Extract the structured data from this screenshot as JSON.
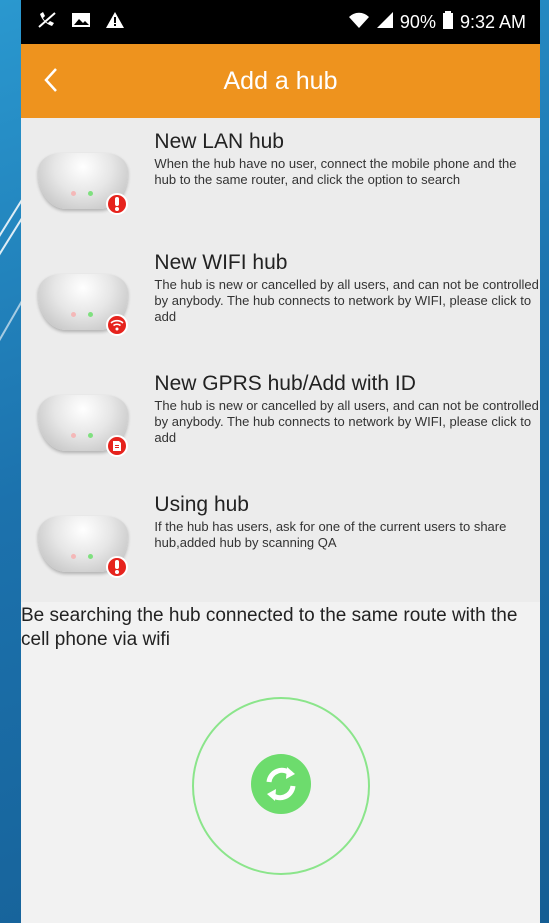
{
  "status_bar": {
    "icons_left": [
      "no-call-icon",
      "image-icon",
      "warning-icon"
    ],
    "battery": "90%",
    "time": "9:32 AM"
  },
  "header": {
    "title": "Add a hub",
    "back_icon": "chevron-left-icon"
  },
  "hubs": [
    {
      "title": "New LAN hub",
      "description": "When the hub have no user, connect the mobile phone and the hub to the same router, and click the option to search",
      "badge_icon": "exclamation-icon"
    },
    {
      "title": "New WIFI hub",
      "description": "The hub is new or cancelled by all users, and can not be controlled by anybody. The hub connects to network by WIFI, please click to add",
      "badge_icon": "wifi-icon"
    },
    {
      "title": "New GPRS hub/Add with ID",
      "description": "The hub is new or cancelled by all users, and can not be controlled by anybody. The hub connects to network by WIFI, please click to add",
      "badge_icon": "sim-card-icon"
    },
    {
      "title": "Using hub",
      "description": "If the hub has users, ask for one of the current users to share hub,added hub by scanning QA",
      "badge_icon": "exclamation-icon"
    }
  ],
  "search": {
    "message": "Be searching the hub connected to the same route with the cell phone via wifi",
    "refresh_icon": "refresh-icon"
  },
  "colors": {
    "accent": "#ee931e",
    "badge": "#e6231d",
    "ring": "#8be58b",
    "refresh": "#6ddc6d"
  }
}
